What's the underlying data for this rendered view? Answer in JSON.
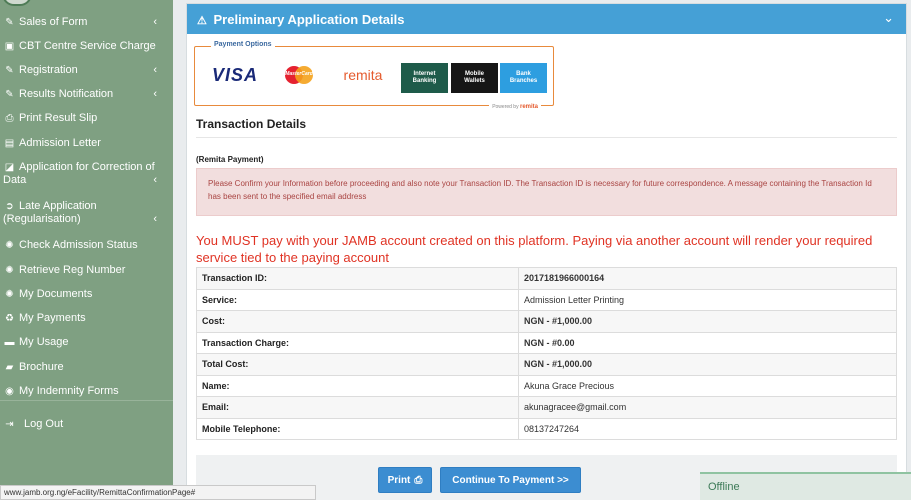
{
  "sidebar": {
    "items": [
      {
        "label": "Sales of Form",
        "icon": "edit-icon",
        "chevron": "‹"
      },
      {
        "label": "CBT Centre Service Charge",
        "icon": "money-icon",
        "chevron": ""
      },
      {
        "label": "Registration",
        "icon": "edit-icon",
        "chevron": "‹"
      },
      {
        "label": "Results Notification",
        "icon": "edit-icon",
        "chevron": "‹"
      },
      {
        "label": "Print Result Slip",
        "icon": "print-icon",
        "chevron": ""
      },
      {
        "label": "Admission Letter",
        "icon": "document-icon",
        "chevron": ""
      },
      {
        "label": "Application for Correction of",
        "label2": "Data",
        "icon": "edit-square-icon",
        "chevron": "‹"
      },
      {
        "label": "Late Application",
        "label2": "(Regularisation)",
        "icon": "arrow-circle-icon",
        "chevron": "‹"
      },
      {
        "label": "Check Admission Status",
        "icon": "gear-icon",
        "chevron": ""
      },
      {
        "label": "Retrieve Reg Number",
        "icon": "gear-icon",
        "chevron": ""
      },
      {
        "label": "My Documents",
        "icon": "gear-icon",
        "chevron": ""
      },
      {
        "label": "My Payments",
        "icon": "recycle-icon",
        "chevron": ""
      },
      {
        "label": "My Usage",
        "icon": "cart-icon",
        "chevron": ""
      },
      {
        "label": "Brochure",
        "icon": "book-icon",
        "chevron": ""
      },
      {
        "label": "My Indemnity Forms",
        "icon": "info-circle-icon",
        "chevron": ""
      },
      {
        "label": "Log Out",
        "icon": "sign-out-icon",
        "chevron": ""
      }
    ]
  },
  "panel": {
    "title": "Preliminary Application Details",
    "title_icon": "⚠",
    "toggle_icon": "⌄"
  },
  "payment_options": {
    "title": "Payment Options",
    "logos": [
      "VISA",
      "MasterCard",
      "remita"
    ],
    "tiles": [
      {
        "line1": "Internet",
        "line2": "Banking"
      },
      {
        "line1": "Mobile",
        "line2": "Wallets"
      },
      {
        "line1": "Bank",
        "line2": "Branches"
      }
    ],
    "powered_by": "Powered by",
    "powered_brand": "remita"
  },
  "transaction": {
    "section_title": "Transaction Details",
    "method_label": "(Remita Payment)",
    "alert": "Please Confirm your Information before proceeding and also note your Transaction ID. The Transaction ID is necessary for future correspondence. A message containing the Transaction Id has been sent to the specified email address",
    "warning": "You MUST pay with your JAMB account created on this platform. Paying via another account will render your required service tied to the paying account",
    "rows": [
      {
        "label": "Transaction ID:",
        "value": "2017181966000164"
      },
      {
        "label": "Service:",
        "value": "Admission Letter Printing"
      },
      {
        "label": "Cost:",
        "value": "NGN - #1,000.00"
      },
      {
        "label": "Transaction Charge:",
        "value": "NGN - #0.00"
      },
      {
        "label": "Total Cost:",
        "value": "NGN - #1,000.00"
      },
      {
        "label": "Name:",
        "value": "Akuna Grace Precious"
      },
      {
        "label": "Email:",
        "value": "akunagracee@gmail.com"
      },
      {
        "label": "Mobile Telephone:",
        "value": "08137247264"
      }
    ]
  },
  "buttons": {
    "print": "Print",
    "continue": "Continue To Payment >>"
  },
  "chat": {
    "status": "Offline"
  },
  "status_bar": {
    "url": "www.jamb.org.ng/eFacility/RemittaConfirmationPage#"
  },
  "colors": {
    "sidebar_bg": "#7fa082",
    "header_bg": "#45a0d6",
    "alert_bg": "#f2dede",
    "warning_text": "#e03324",
    "button_bg": "#3c8dd1"
  }
}
